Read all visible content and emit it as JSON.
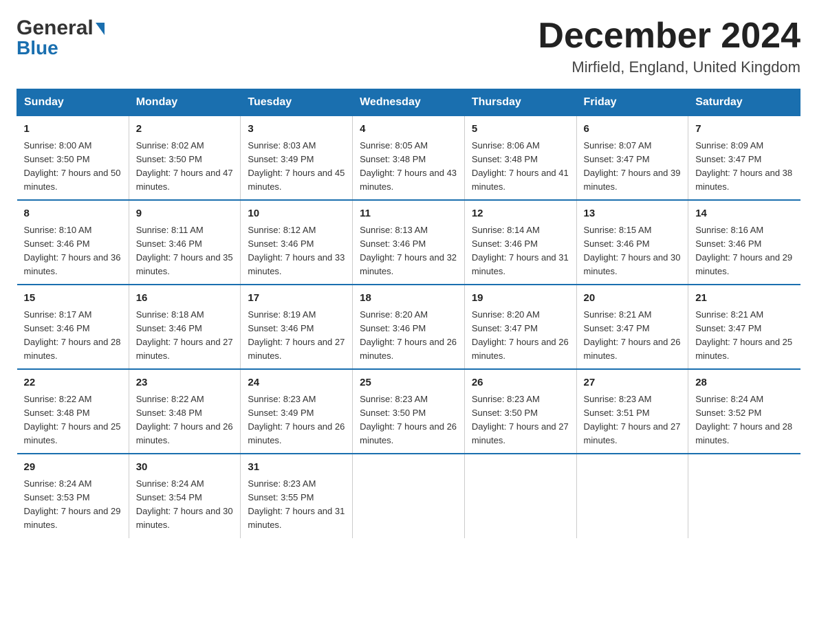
{
  "header": {
    "logo_general": "General",
    "logo_blue": "Blue",
    "title": "December 2024",
    "subtitle": "Mirfield, England, United Kingdom"
  },
  "columns": [
    "Sunday",
    "Monday",
    "Tuesday",
    "Wednesday",
    "Thursday",
    "Friday",
    "Saturday"
  ],
  "weeks": [
    [
      {
        "day": "1",
        "sunrise": "8:00 AM",
        "sunset": "3:50 PM",
        "daylight": "7 hours and 50 minutes."
      },
      {
        "day": "2",
        "sunrise": "8:02 AM",
        "sunset": "3:50 PM",
        "daylight": "7 hours and 47 minutes."
      },
      {
        "day": "3",
        "sunrise": "8:03 AM",
        "sunset": "3:49 PM",
        "daylight": "7 hours and 45 minutes."
      },
      {
        "day": "4",
        "sunrise": "8:05 AM",
        "sunset": "3:48 PM",
        "daylight": "7 hours and 43 minutes."
      },
      {
        "day": "5",
        "sunrise": "8:06 AM",
        "sunset": "3:48 PM",
        "daylight": "7 hours and 41 minutes."
      },
      {
        "day": "6",
        "sunrise": "8:07 AM",
        "sunset": "3:47 PM",
        "daylight": "7 hours and 39 minutes."
      },
      {
        "day": "7",
        "sunrise": "8:09 AM",
        "sunset": "3:47 PM",
        "daylight": "7 hours and 38 minutes."
      }
    ],
    [
      {
        "day": "8",
        "sunrise": "8:10 AM",
        "sunset": "3:46 PM",
        "daylight": "7 hours and 36 minutes."
      },
      {
        "day": "9",
        "sunrise": "8:11 AM",
        "sunset": "3:46 PM",
        "daylight": "7 hours and 35 minutes."
      },
      {
        "day": "10",
        "sunrise": "8:12 AM",
        "sunset": "3:46 PM",
        "daylight": "7 hours and 33 minutes."
      },
      {
        "day": "11",
        "sunrise": "8:13 AM",
        "sunset": "3:46 PM",
        "daylight": "7 hours and 32 minutes."
      },
      {
        "day": "12",
        "sunrise": "8:14 AM",
        "sunset": "3:46 PM",
        "daylight": "7 hours and 31 minutes."
      },
      {
        "day": "13",
        "sunrise": "8:15 AM",
        "sunset": "3:46 PM",
        "daylight": "7 hours and 30 minutes."
      },
      {
        "day": "14",
        "sunrise": "8:16 AM",
        "sunset": "3:46 PM",
        "daylight": "7 hours and 29 minutes."
      }
    ],
    [
      {
        "day": "15",
        "sunrise": "8:17 AM",
        "sunset": "3:46 PM",
        "daylight": "7 hours and 28 minutes."
      },
      {
        "day": "16",
        "sunrise": "8:18 AM",
        "sunset": "3:46 PM",
        "daylight": "7 hours and 27 minutes."
      },
      {
        "day": "17",
        "sunrise": "8:19 AM",
        "sunset": "3:46 PM",
        "daylight": "7 hours and 27 minutes."
      },
      {
        "day": "18",
        "sunrise": "8:20 AM",
        "sunset": "3:46 PM",
        "daylight": "7 hours and 26 minutes."
      },
      {
        "day": "19",
        "sunrise": "8:20 AM",
        "sunset": "3:47 PM",
        "daylight": "7 hours and 26 minutes."
      },
      {
        "day": "20",
        "sunrise": "8:21 AM",
        "sunset": "3:47 PM",
        "daylight": "7 hours and 26 minutes."
      },
      {
        "day": "21",
        "sunrise": "8:21 AM",
        "sunset": "3:47 PM",
        "daylight": "7 hours and 25 minutes."
      }
    ],
    [
      {
        "day": "22",
        "sunrise": "8:22 AM",
        "sunset": "3:48 PM",
        "daylight": "7 hours and 25 minutes."
      },
      {
        "day": "23",
        "sunrise": "8:22 AM",
        "sunset": "3:48 PM",
        "daylight": "7 hours and 26 minutes."
      },
      {
        "day": "24",
        "sunrise": "8:23 AM",
        "sunset": "3:49 PM",
        "daylight": "7 hours and 26 minutes."
      },
      {
        "day": "25",
        "sunrise": "8:23 AM",
        "sunset": "3:50 PM",
        "daylight": "7 hours and 26 minutes."
      },
      {
        "day": "26",
        "sunrise": "8:23 AM",
        "sunset": "3:50 PM",
        "daylight": "7 hours and 27 minutes."
      },
      {
        "day": "27",
        "sunrise": "8:23 AM",
        "sunset": "3:51 PM",
        "daylight": "7 hours and 27 minutes."
      },
      {
        "day": "28",
        "sunrise": "8:24 AM",
        "sunset": "3:52 PM",
        "daylight": "7 hours and 28 minutes."
      }
    ],
    [
      {
        "day": "29",
        "sunrise": "8:24 AM",
        "sunset": "3:53 PM",
        "daylight": "7 hours and 29 minutes."
      },
      {
        "day": "30",
        "sunrise": "8:24 AM",
        "sunset": "3:54 PM",
        "daylight": "7 hours and 30 minutes."
      },
      {
        "day": "31",
        "sunrise": "8:23 AM",
        "sunset": "3:55 PM",
        "daylight": "7 hours and 31 minutes."
      },
      null,
      null,
      null,
      null
    ]
  ]
}
